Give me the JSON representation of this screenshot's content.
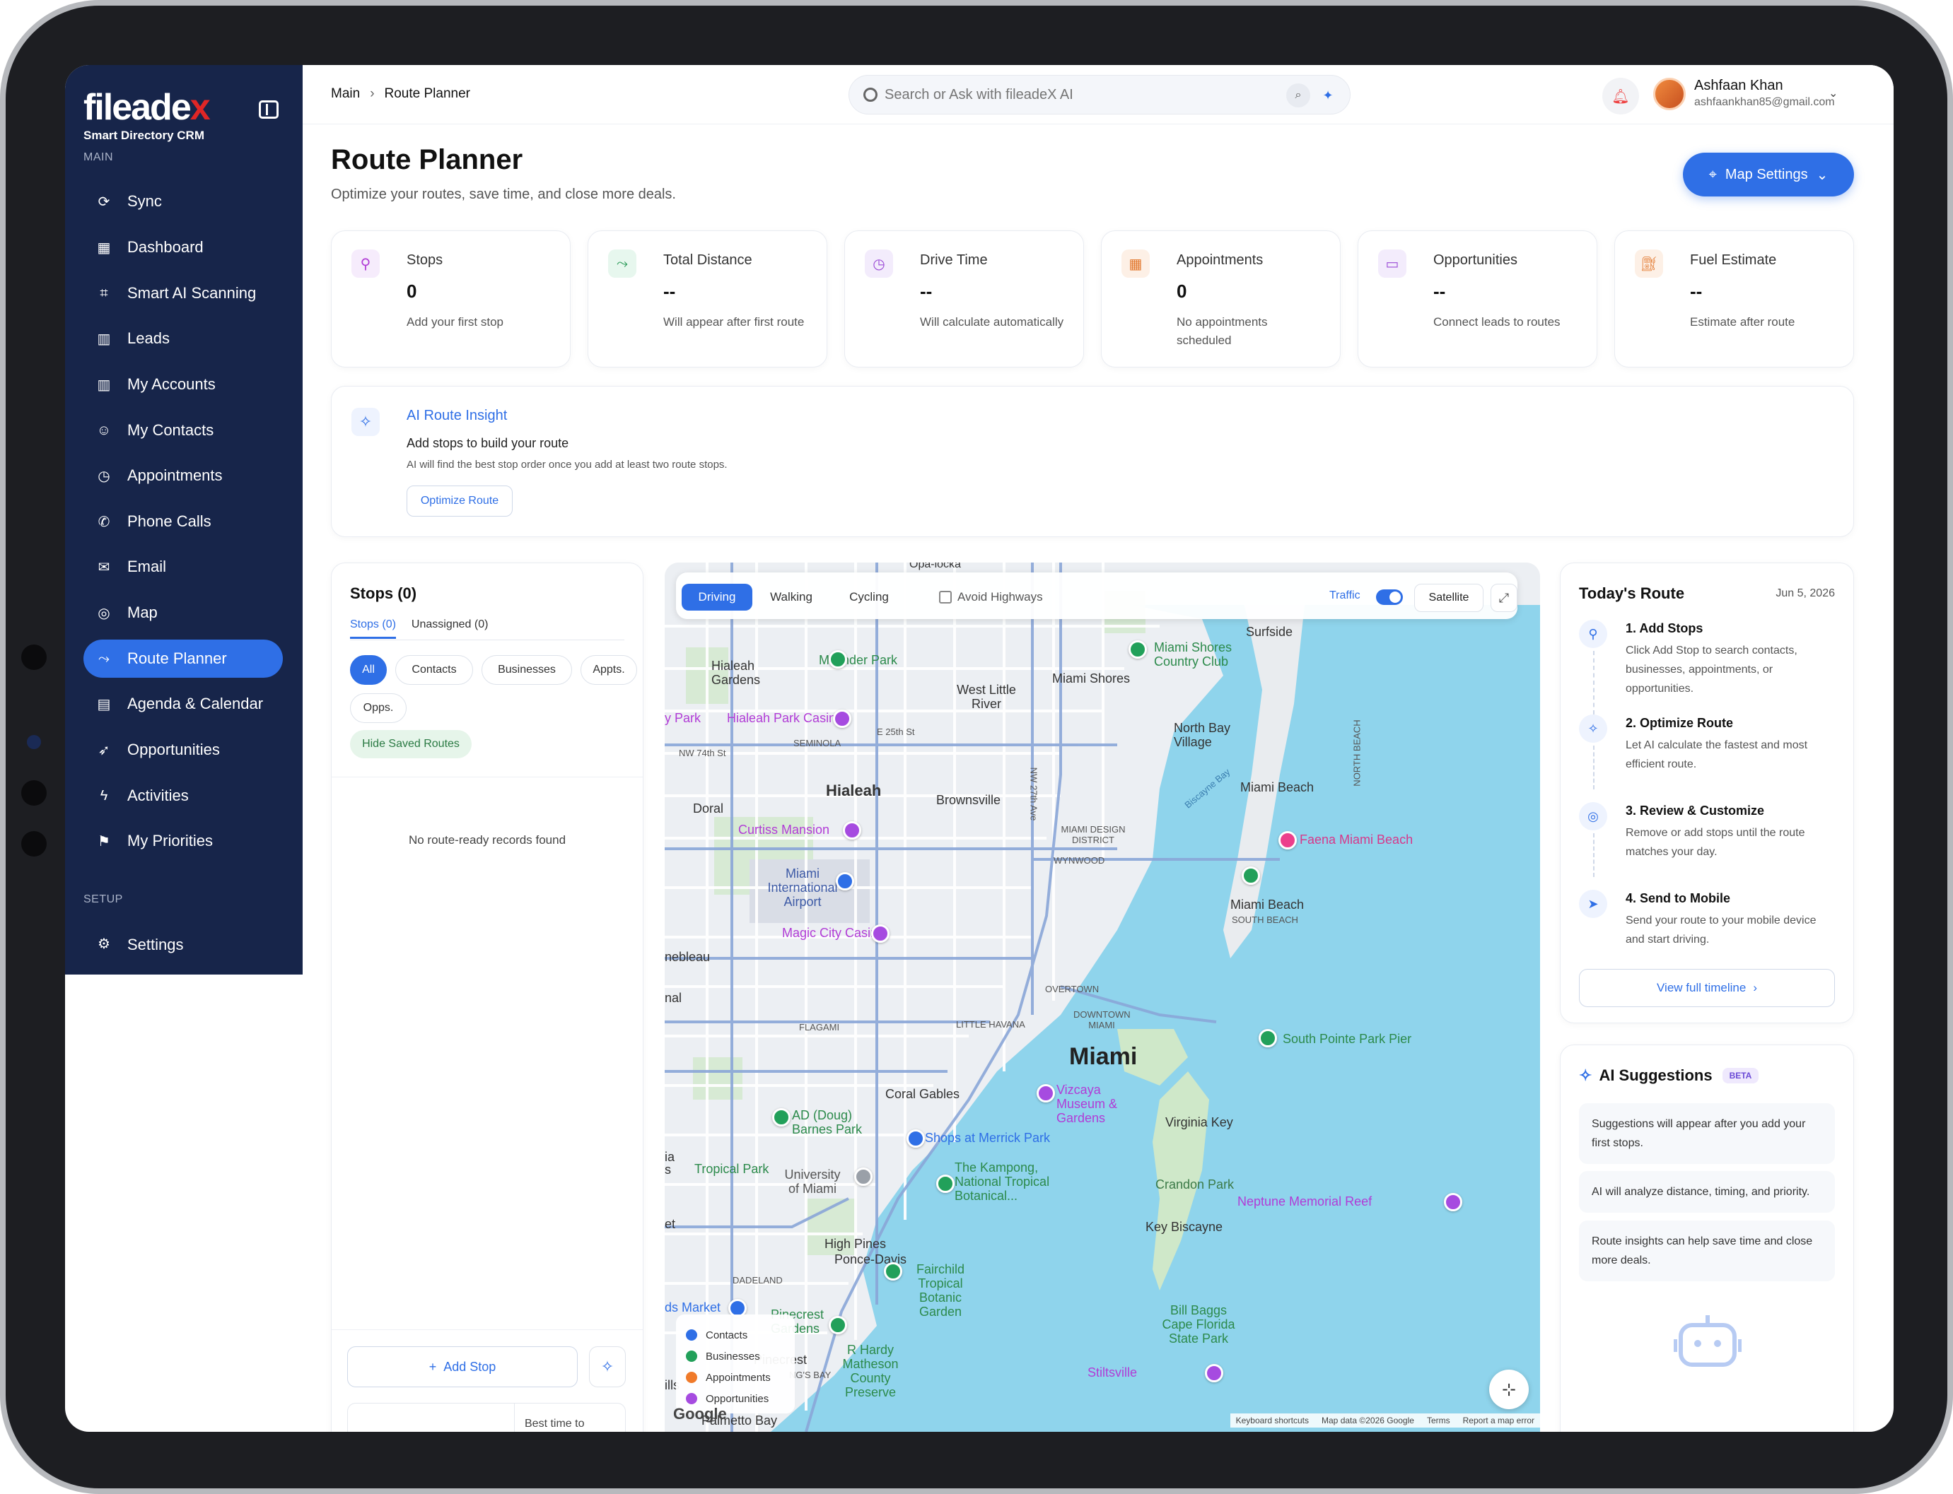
{
  "brand": {
    "name_main": "fileade",
    "name_x": "x",
    "tagline": "Smart Directory CRM"
  },
  "sidebar": {
    "section_main": "MAIN",
    "section_setup": "SETUP",
    "items": [
      {
        "label": "Sync",
        "icon": "sync-icon"
      },
      {
        "label": "Dashboard",
        "icon": "dashboard-icon"
      },
      {
        "label": "Smart AI Scanning",
        "icon": "scan-icon"
      },
      {
        "label": "Leads",
        "icon": "building-icon"
      },
      {
        "label": "My Accounts",
        "icon": "building-icon"
      },
      {
        "label": "My Contacts",
        "icon": "contacts-icon"
      },
      {
        "label": "Appointments",
        "icon": "clock-icon"
      },
      {
        "label": "Phone Calls",
        "icon": "phone-icon"
      },
      {
        "label": "Email",
        "icon": "mail-icon"
      },
      {
        "label": "Map",
        "icon": "map-icon"
      },
      {
        "label": "Route Planner",
        "icon": "route-icon",
        "active": true
      },
      {
        "label": "Agenda & Calendar",
        "icon": "calendar-icon"
      },
      {
        "label": "Opportunities",
        "icon": "rocket-icon"
      },
      {
        "label": "Activities",
        "icon": "bolt-icon"
      },
      {
        "label": "My Priorities",
        "icon": "flag-icon"
      }
    ],
    "settings": "Settings"
  },
  "topbar": {
    "breadcrumb": [
      "Main",
      "Route Planner"
    ],
    "search_placeholder": "Search or Ask with fileadeX AI",
    "user_name": "Ashfaan Khan",
    "user_email": "ashfaankhan85@gmail.com"
  },
  "page": {
    "title": "Route Planner",
    "subtitle": "Optimize your routes, save time, and close more deals.",
    "map_settings": "Map Settings"
  },
  "stats": [
    {
      "title": "Stops",
      "value": "0",
      "desc": "Add your first stop",
      "icon": "location-icon",
      "color": "#b13cd6",
      "bg": "#f6ecfc"
    },
    {
      "title": "Total Distance",
      "value": "--",
      "desc": "Will appear after first route",
      "icon": "route-icon",
      "color": "#2a9a57",
      "bg": "#e7f7ee"
    },
    {
      "title": "Drive Time",
      "value": "--",
      "desc": "Will calculate automatically",
      "icon": "clock-icon",
      "color": "#9b4bd6",
      "bg": "#f3ecfc"
    },
    {
      "title": "Appointments",
      "value": "0",
      "desc": "No appointments scheduled",
      "icon": "calendar-icon",
      "color": "#e2762b",
      "bg": "#fdf0e6"
    },
    {
      "title": "Opportunities",
      "value": "--",
      "desc": "Connect leads to routes",
      "icon": "briefcase-icon",
      "color": "#9b4bd6",
      "bg": "#f3ecfc"
    },
    {
      "title": "Fuel Estimate",
      "value": "--",
      "desc": "Estimate after route",
      "icon": "fuel-icon",
      "color": "#e2762b",
      "bg": "#fdf0e6"
    }
  ],
  "ai_insight": {
    "title": "AI Route Insight",
    "subtitle": "Add stops to build your route",
    "desc": "AI will find the best stop order once you add at least two route stops.",
    "button": "Optimize Route"
  },
  "stops_panel": {
    "title": "Stops (0)",
    "tabs": [
      "Stops (0)",
      "Unassigned (0)"
    ],
    "filters": [
      "All",
      "Contacts",
      "Businesses",
      "Appts.",
      "Opps."
    ],
    "hide_saved": "Hide Saved Routes",
    "empty": "No route-ready records found",
    "add_stop": "Add Stop",
    "best_time": "Best time to"
  },
  "map": {
    "modes": [
      "Driving",
      "Walking",
      "Cycling"
    ],
    "avoid_highways": "Avoid Highways",
    "traffic": "Traffic",
    "traffic_on": true,
    "satellite": "Satellite",
    "legend": [
      {
        "label": "Contacts",
        "color": "#2f6fe6"
      },
      {
        "label": "Businesses",
        "color": "#22a05a"
      },
      {
        "label": "Appointments",
        "color": "#f07a2a"
      },
      {
        "label": "Opportunities",
        "color": "#a64be0"
      }
    ],
    "labels": {
      "miami": "Miami",
      "hialeah": "Hialeah",
      "hialeah_gardens": "Hialeah Gardens",
      "west_little_river": "West Little River",
      "miami_shores": "Miami Shores",
      "north_bay_village": "North Bay Village",
      "miami_beach": "Miami Beach",
      "miami_beach_2": "Miami Beach",
      "surfside": "Surfside",
      "brownsville": "Brownsville",
      "doral": "Doral",
      "coral_gables": "Coral Gables",
      "virginia_key": "Virginia Key",
      "key_biscayne": "Key Biscayne",
      "crandon_park": "Crandon Park",
      "high_pines": "High Pines",
      "ponce_davis": "Ponce-Davis",
      "pinecrest": "Pinecrest",
      "pinecrest_gardens": "Pinecrest Gardens",
      "bill_baggs": "Bill Baggs Cape Florida State Park",
      "airport": "Miami International Airport",
      "university": "University of Miami",
      "tropical_park": "Tropical Park",
      "ad_barnes": "AD (Doug) Barnes Park",
      "kampong": "The Kampong, National Tropical Botanical...",
      "fairchild": "Fairchild Tropical Botanic Garden",
      "r_hardy": "R Hardy Matheson County Preserve",
      "milander": "Milander Park",
      "hialeah_casino": "Hialeah Park Casino",
      "curtiss": "Curtiss Mansion",
      "magic_city": "Magic City Casino",
      "vizcaya": "Vizcaya Museum & Gardens",
      "faena": "Faena Miami Beach",
      "south_pointe": "South Pointe Park Pier",
      "neptune": "Neptune Memorial Reef",
      "stiltsville": "Stiltsville",
      "shops_merrick": "Shops at Merrick Park",
      "mshores_cc": "Miami Shores Country Club",
      "north_beach": "NORTH BEACH",
      "south_beach": "SOUTH BEACH",
      "overtown": "OVERTOWN",
      "downtown": "DOWNTOWN MIAMI",
      "flagami": "FLAGAMI",
      "little_havana": "LITTLE HAVANA",
      "wynwood": "WYNWOOD",
      "design_district": "MIAMI DESIGN DISTRICT",
      "seminola": "SEMINOLA",
      "dadeland": "DADELAND",
      "biscayne_bay": "Biscayne Bay",
      "nebleau": "nebleau",
      "y_park": "y Park",
      "nal": "nal",
      "et": "et",
      "ia_s": "ia s",
      "ds_market": "ds Market",
      "ills": "ills",
      "ngs_bay": "NG'S BAY",
      "opa_locka": "Opa-locka",
      "nw74": "NW 74th St",
      "e25": "E 25th St",
      "nw27": "NW 27th Ave",
      "palmetto": "Palmetto Bay",
      "google": "Google"
    },
    "attribution": [
      "Keyboard shortcuts",
      "Map data ©2026 Google",
      "Terms",
      "Report a map error"
    ]
  },
  "today_route": {
    "title": "Today's Route",
    "date": "Jun 5, 2026",
    "steps": [
      {
        "title": "1. Add Stops",
        "body": "Click Add Stop to search contacts, businesses, appointments, or opportunities.",
        "icon": "location-icon"
      },
      {
        "title": "2. Optimize Route",
        "body": "Let AI calculate the fastest and most efficient route.",
        "icon": "sparkle-icon"
      },
      {
        "title": "3. Review & Customize",
        "body": "Remove or add stops until the route matches your day.",
        "icon": "target-icon"
      },
      {
        "title": "4. Send to Mobile",
        "body": "Send your route to your mobile device and start driving.",
        "icon": "send-icon"
      }
    ],
    "view_timeline": "View full timeline"
  },
  "ai_suggestions": {
    "title": "AI Suggestions",
    "badge": "BETA",
    "items": [
      "Suggestions will appear after you add your first stops.",
      "AI will analyze distance, timing, and priority.",
      "Route insights can help save time and close more deals."
    ]
  }
}
